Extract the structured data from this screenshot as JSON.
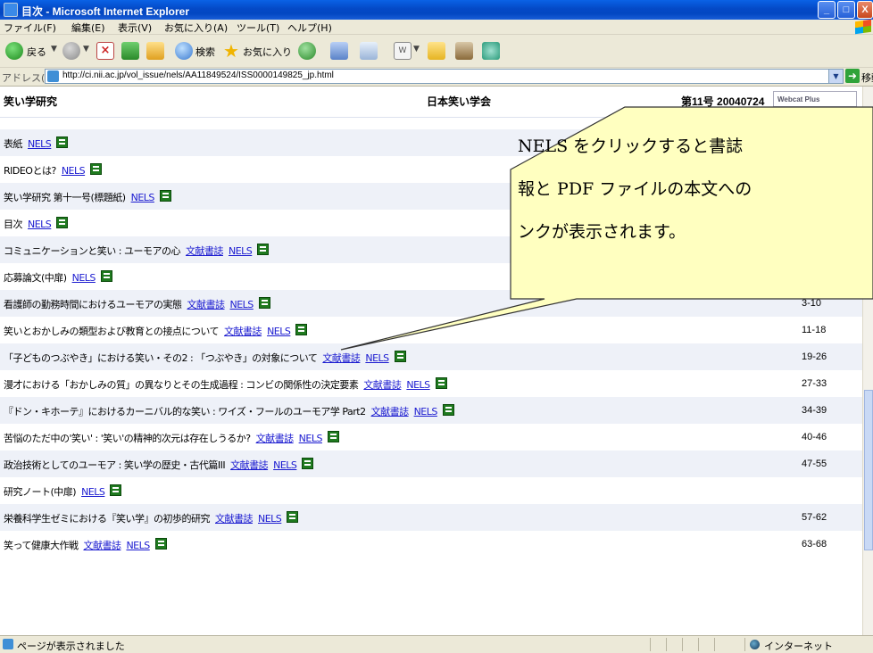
{
  "window": {
    "title": "目次 - Microsoft Internet Explorer",
    "buttons": {
      "minimize": "_",
      "maximize": "□",
      "close": "X"
    }
  },
  "menu": [
    "ファイル(F)",
    "編集(E)",
    "表示(V)",
    "お気に入り(A)",
    "ツール(T)",
    "ヘルプ(H)"
  ],
  "toolbar": {
    "back_label": "戻る",
    "search_label": "検索",
    "favorites_label": "お気に入り"
  },
  "address": {
    "label": "アドレス(D)",
    "url": "http://ci.nii.ac.jp/vol_issue/nels/AA11849524/ISS0000149825_jp.html",
    "go_label": "移動"
  },
  "header": {
    "journal": "笑い学研究",
    "society": "日本笑い学会",
    "issue": "第11号 20040724",
    "logo_text": "Webcat Plus"
  },
  "link_labels": {
    "nels": "NELS",
    "bunken": "文献書誌"
  },
  "articles": [
    {
      "title": "表紙",
      "bunken": false,
      "pages": ""
    },
    {
      "title": "RIDEOとは?",
      "bunken": false,
      "pages": ""
    },
    {
      "title": "笑い学研究 第十一号(標題紙)",
      "bunken": false,
      "pages": ""
    },
    {
      "title": "目次",
      "bunken": false,
      "pages": ""
    },
    {
      "title": "コミュニケーションと笑い : ユーモアの心",
      "bunken": true,
      "pages": ""
    },
    {
      "title": "応募論文(中扉)",
      "bunken": false,
      "pages": ""
    },
    {
      "title": "看護師の勤務時間におけるユーモアの実態",
      "bunken": true,
      "pages": "3-10"
    },
    {
      "title": "笑いとおかしみの類型および教育との接点について",
      "bunken": true,
      "pages": "11-18"
    },
    {
      "title": "「子どものつぶやき」における笑い・その2 : 「つぶやき」の対象について",
      "bunken": true,
      "pages": "19-26"
    },
    {
      "title": "漫才における「おかしみの質」の異なりとその生成過程 : コンビの関係性の決定要素",
      "bunken": true,
      "pages": "27-33"
    },
    {
      "title": "『ドン・キホーテ』におけるカーニバル的な笑い : ワイズ・フールのユーモア学 Part2",
      "bunken": true,
      "pages": "34-39"
    },
    {
      "title": "苦悩のただ中の'笑い' : '笑い'の精神的次元は存在しうるか?",
      "bunken": true,
      "pages": "40-46"
    },
    {
      "title": "政治技術としてのユーモア : 笑い学の歴史・古代篇III",
      "bunken": true,
      "pages": "47-55"
    },
    {
      "title": "研究ノート(中扉)",
      "bunken": false,
      "pages": ""
    },
    {
      "title": "栄養科学生ゼミにおける『笑い学』の初歩的研究",
      "bunken": true,
      "pages": "57-62"
    },
    {
      "title": "笑って健康大作戦",
      "bunken": true,
      "pages": "63-68"
    }
  ],
  "callout": {
    "lines": [
      "NELS をクリックすると書誌",
      "報と PDF ファイルの本文への",
      "ンクが表示されます。"
    ]
  },
  "status": {
    "message": "ページが表示されました",
    "zone": "インターネット"
  }
}
